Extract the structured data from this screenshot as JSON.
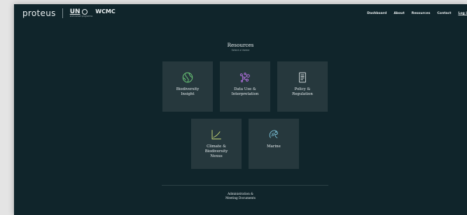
{
  "brand": {
    "name": "proteus",
    "un_text": "UN",
    "un_subtext": "environment programme",
    "wcmc": "WCMC"
  },
  "nav": {
    "items": [
      "Dashboard",
      "About",
      "Resources",
      "Contact"
    ],
    "login": "Log i"
  },
  "page": {
    "title": "Resources",
    "subtitle": "Select a theme"
  },
  "tiles": [
    {
      "line1": "Biodiversity",
      "line2": "Insight",
      "line3": "",
      "icon": "globe-icon",
      "icon_color": "#6fd07a"
    },
    {
      "line1": "Data Use &",
      "line2": "Interpretation",
      "line3": "",
      "icon": "molecule-icon",
      "icon_color": "#b873e6"
    },
    {
      "line1": "Policy &",
      "line2": "Regulation",
      "line3": "",
      "icon": "document-icon",
      "icon_color": "#cfd6d8"
    },
    {
      "line1": "Climate &",
      "line2": "Biodiversity",
      "line3": "Nexus",
      "icon": "chart-icon",
      "icon_color": "#cfe07a"
    },
    {
      "line1": "Marine",
      "line2": "",
      "line3": "",
      "icon": "fish-icon",
      "icon_color": "#7fc8e0"
    }
  ],
  "admin": {
    "line1": "Administration &",
    "line2": "Meeting Documents"
  }
}
